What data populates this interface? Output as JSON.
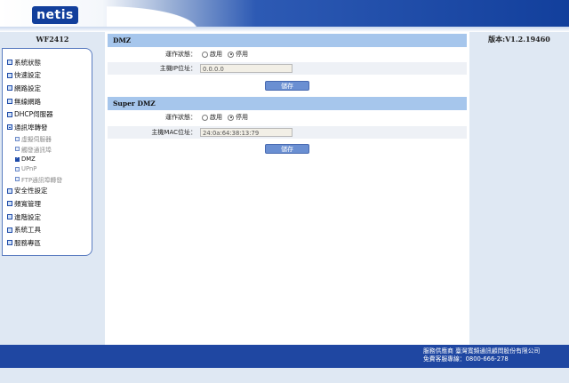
{
  "brand": {
    "logo_text": "netis",
    "color": "#123f9c"
  },
  "device": {
    "model": "WF2412",
    "version": "版本:V1.2.19460"
  },
  "menu": {
    "items": [
      {
        "label": "系統狀態"
      },
      {
        "label": "快速設定"
      },
      {
        "label": "網路設定"
      },
      {
        "label": "無線網路"
      },
      {
        "label": "DHCP伺服器"
      },
      {
        "label": "通訊埠轉發"
      },
      {
        "label": "安全性設定"
      },
      {
        "label": "頻寬管理"
      },
      {
        "label": "進階設定"
      },
      {
        "label": "系統工具"
      },
      {
        "label": "服務專區"
      }
    ],
    "sub_items": [
      {
        "label": "虛擬伺服器"
      },
      {
        "label": "觸發通訊埠"
      },
      {
        "label": "DMZ"
      },
      {
        "label": "UPnP"
      },
      {
        "label": "FTP通訊埠轉發"
      }
    ]
  },
  "dmz": {
    "title": "DMZ",
    "status_label": "運作狀態：",
    "enable_label": "啟用",
    "disable_label": "停用",
    "host_ip_label": "主機IP位址：",
    "host_ip_value": "0.0.0.0",
    "save_label": "儲存"
  },
  "super_dmz": {
    "title": "Super DMZ",
    "status_label": "運作狀態：",
    "enable_label": "啟用",
    "disable_label": "停用",
    "host_mac_label": "主機MAC位址：",
    "host_mac_value": "24:0a:64:38:13:79",
    "save_label": "儲存"
  },
  "footer": {
    "provider": "服務供應商 臺灣寬頻通訊顧問股份有限公司",
    "hotline": "免費客服專線：0800-666-278"
  }
}
